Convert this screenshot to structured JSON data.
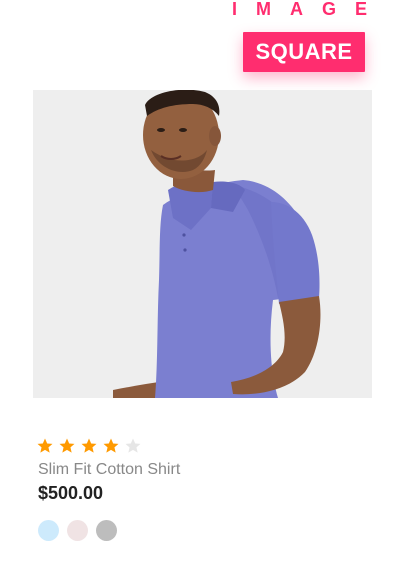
{
  "header": {
    "title": "IMAGE",
    "badge": "SQUARE",
    "accent_color": "#ff2d6f"
  },
  "product": {
    "image_icon": "product-photo-man-polo-shirt",
    "rating": {
      "filled": 4,
      "total": 5,
      "filled_color": "#ff9a00",
      "empty_color": "#e6e6e6"
    },
    "name": "Slim Fit Cotton Shirt",
    "price": "$500.00",
    "swatches": [
      {
        "name": "light-blue",
        "color": "#cdeafc"
      },
      {
        "name": "light-pink",
        "color": "#f0e3e4"
      },
      {
        "name": "gray",
        "color": "#bdbdbd"
      }
    ]
  }
}
